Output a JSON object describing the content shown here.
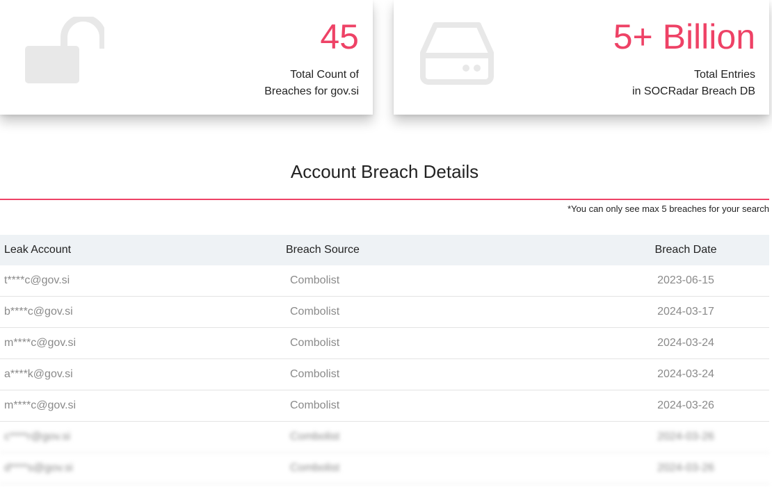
{
  "cards": [
    {
      "number": "45",
      "label_line1": "Total Count of",
      "label_line2": "Breaches for gov.si",
      "icon": "unlocked-padlock-icon"
    },
    {
      "number": "5+ Billion",
      "label_line1": "Total Entries",
      "label_line2": "in SOCRadar Breach DB",
      "icon": "hard-drive-icon"
    }
  ],
  "section": {
    "title": "Account Breach Details",
    "note": "*You can only see max 5 breaches for your search"
  },
  "table": {
    "headers": {
      "account": "Leak Account",
      "source": "Breach Source",
      "date": "Breach Date"
    },
    "rows": [
      {
        "account": "t****c@gov.si",
        "source": "Combolist",
        "date": "2023-06-15"
      },
      {
        "account": "b****c@gov.si",
        "source": "Combolist",
        "date": "2024-03-17"
      },
      {
        "account": "m****c@gov.si",
        "source": "Combolist",
        "date": "2024-03-24"
      },
      {
        "account": "a****k@gov.si",
        "source": "Combolist",
        "date": "2024-03-24"
      },
      {
        "account": "m****c@gov.si",
        "source": "Combolist",
        "date": "2024-03-26"
      },
      {
        "account": "c****r@gov.si",
        "source": "Combolist",
        "date": "2024-03-26"
      },
      {
        "account": "d****s@gov.si",
        "source": "Combolist",
        "date": "2024-03-26"
      }
    ]
  },
  "colors": {
    "accent": "#ee4266",
    "header_bg": "#eef2f5",
    "icon_gray": "#e8e8e8"
  }
}
